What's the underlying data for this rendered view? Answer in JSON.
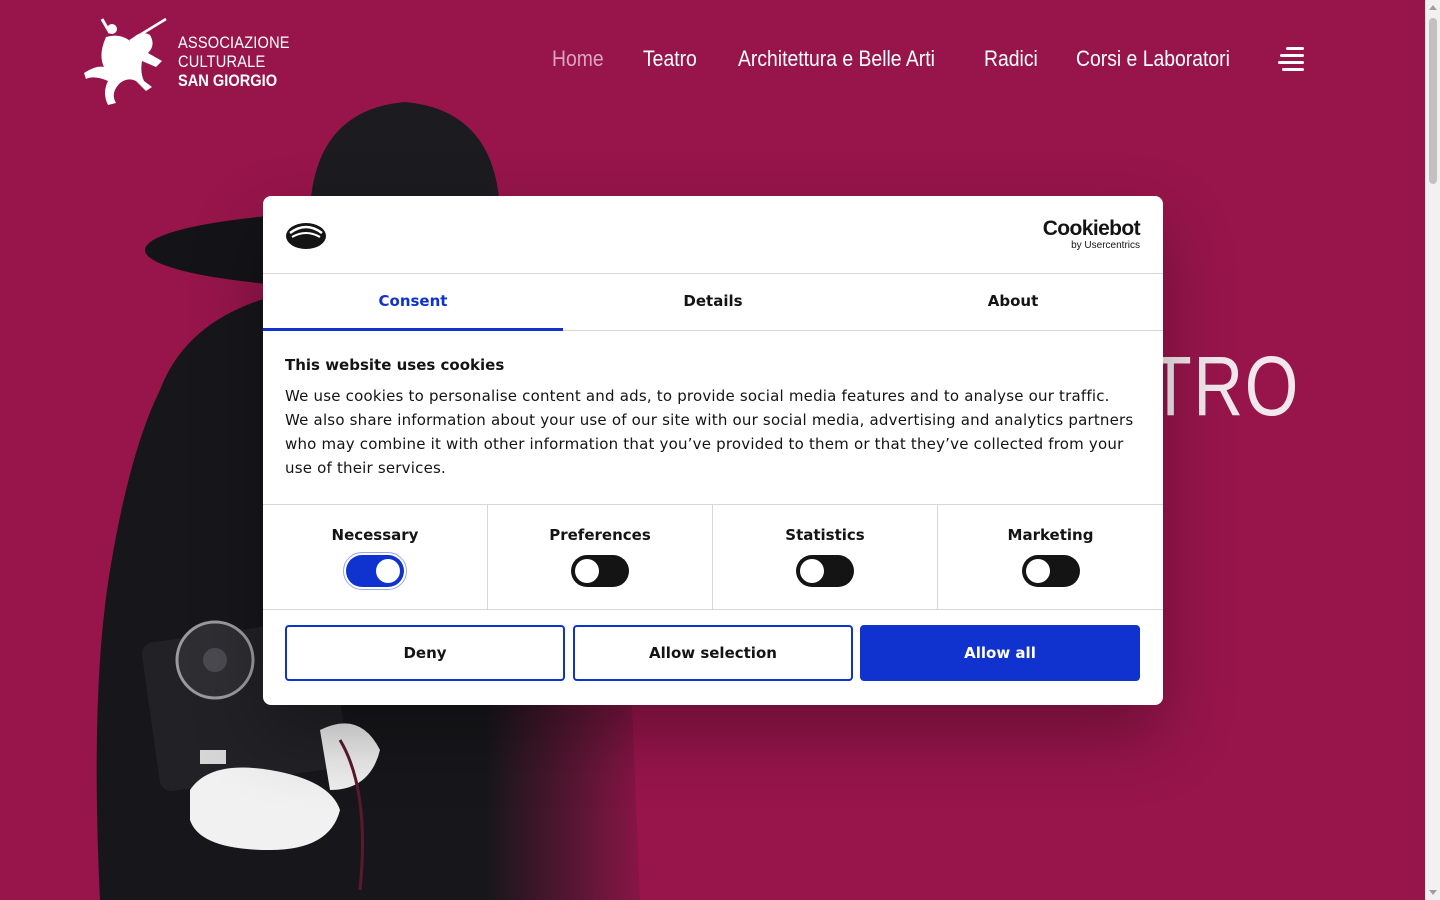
{
  "site": {
    "logo_line1": "ASSOCIAZIONE",
    "logo_line2": "CULTURALE",
    "logo_line3": "SAN GIORGIO",
    "logo_icon": "st-george-horse-rider-icon"
  },
  "nav": {
    "items": [
      {
        "label": "Home",
        "active": true
      },
      {
        "label": "Teatro",
        "active": false
      },
      {
        "label": "Architettura e Belle Arti",
        "active": false
      },
      {
        "label": "Radici",
        "active": false
      },
      {
        "label": "Corsi e Laboratori",
        "active": false
      }
    ],
    "menu_icon": "hamburger-menu-icon"
  },
  "hero": {
    "title_fragment": "TRO"
  },
  "cookie_dialog": {
    "brand_name": "Cookiebot",
    "brand_sub": "by Usercentrics",
    "tabs": [
      {
        "label": "Consent",
        "active": true
      },
      {
        "label": "Details",
        "active": false
      },
      {
        "label": "About",
        "active": false
      }
    ],
    "heading": "This website uses cookies",
    "body": "We use cookies to personalise content and ads, to provide social media features and to analyse our traffic. We also share information about your use of our site with our social media, advertising and analytics partners who may combine it with other information that you’ve provided to them or that they’ve collected from your use of their services.",
    "toggles": [
      {
        "label": "Necessary",
        "on": true
      },
      {
        "label": "Preferences",
        "on": false
      },
      {
        "label": "Statistics",
        "on": false
      },
      {
        "label": "Marketing",
        "on": false
      }
    ],
    "buttons": {
      "deny": "Deny",
      "allow_selection": "Allow selection",
      "allow_all": "Allow all"
    }
  },
  "colors": {
    "background": "#97154b",
    "accent_blue": "#1032cf",
    "nav_active": "#d9a6bd"
  }
}
